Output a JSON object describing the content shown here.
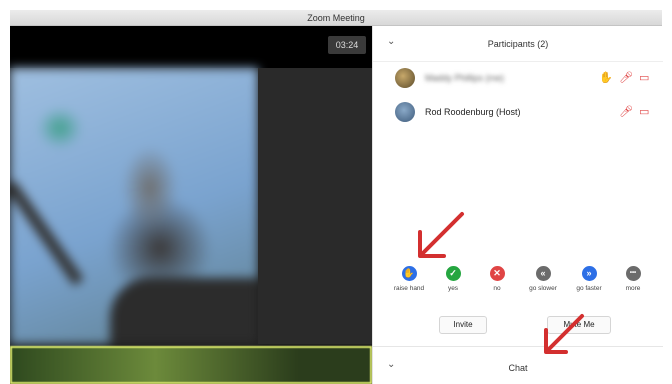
{
  "window": {
    "title": "Zoom Meeting"
  },
  "video": {
    "timer": "03:24"
  },
  "participants_panel": {
    "title": "Participants (2)",
    "participants": [
      {
        "name": "Maddy Phillips (me)",
        "blurred": true,
        "avatar_color": "#7a6a3a"
      },
      {
        "name": "Rod Roodenburg (Host)",
        "blurred": false,
        "avatar_color": "#3d5a7a"
      }
    ]
  },
  "reactions": [
    {
      "label": "raise hand",
      "icon": "raise-hand-icon",
      "glyph": "✋",
      "color": "#2d6fe6"
    },
    {
      "label": "yes",
      "icon": "check-icon",
      "glyph": "✓",
      "color": "#25a640"
    },
    {
      "label": "no",
      "icon": "x-icon",
      "glyph": "✕",
      "color": "#e04545"
    },
    {
      "label": "go slower",
      "icon": "rewind-icon",
      "glyph": "«",
      "color": "#6b6b6b"
    },
    {
      "label": "go faster",
      "icon": "fast-forward-icon",
      "glyph": "»",
      "color": "#2d6fe6"
    },
    {
      "label": "more",
      "icon": "more-icon",
      "glyph": "•••",
      "color": "#6b6b6b"
    }
  ],
  "buttons": {
    "invite": "Invite",
    "mute_me": "Mute Me"
  },
  "chat": {
    "title": "Chat"
  },
  "colors": {
    "accent": "#2d6fe6",
    "alert": "#e04545",
    "annotation_arrow": "#d32f2f"
  }
}
